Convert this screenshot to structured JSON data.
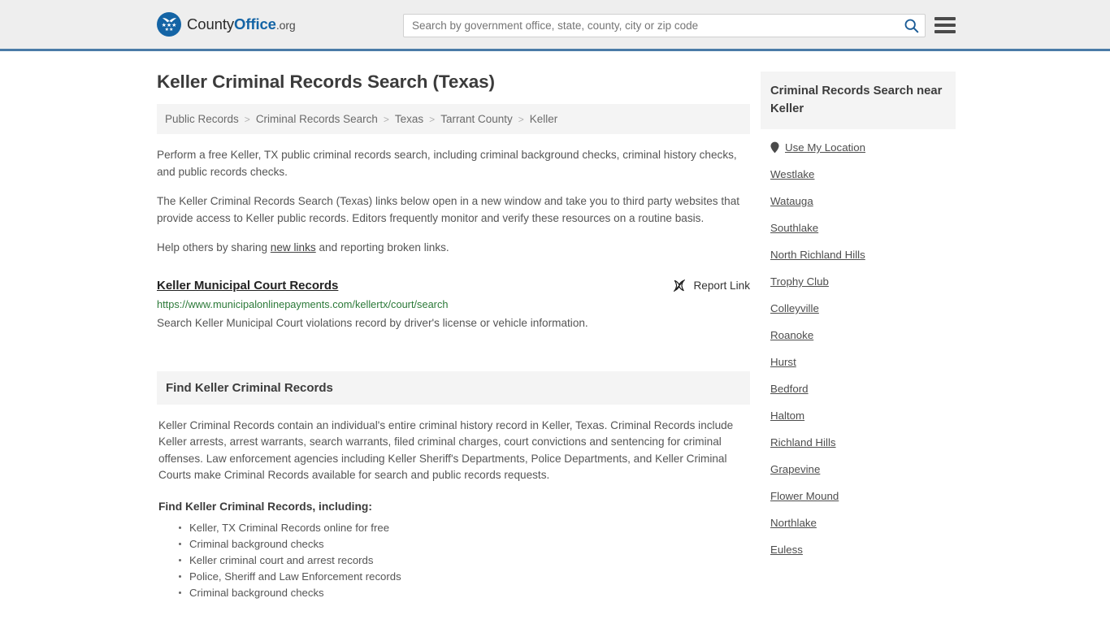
{
  "header": {
    "brand": {
      "part1": "County",
      "part2": "Office",
      "suffix": ".org"
    },
    "search": {
      "placeholder": "Search by government office, state, county, city or zip code",
      "value": "",
      "icon": "search-icon"
    },
    "menu_icon": "hamburger-menu-icon"
  },
  "main": {
    "title": "Keller Criminal Records Search (Texas)",
    "breadcrumb": [
      {
        "label": "Public Records",
        "current": false
      },
      {
        "label": "Criminal Records Search",
        "current": false
      },
      {
        "label": "Texas",
        "current": false
      },
      {
        "label": "Tarrant County",
        "current": false
      },
      {
        "label": "Keller",
        "current": true
      }
    ],
    "breadcrumb_separator": ">",
    "intro_paragraphs": [
      "Perform a free Keller, TX public criminal records search, including criminal background checks, criminal history checks, and public records checks.",
      "The Keller Criminal Records Search (Texas) links below open in a new window and take you to third party websites that provide access to Keller public records. Editors frequently monitor and verify these resources on a routine basis."
    ],
    "share_line": {
      "before": "Help others by sharing ",
      "link": "new links",
      "after": " and reporting broken links."
    },
    "result": {
      "title": "Keller Municipal Court Records",
      "report_label": "Report Link",
      "report_icon": "broken-link-icon",
      "url": "https://www.municipalonlinepayments.com/kellertx/court/search",
      "description": "Search Keller Municipal Court violations record by driver's license or vehicle information."
    },
    "section": {
      "heading": "Find Keller Criminal Records",
      "paragraph": "Keller Criminal Records contain an individual's entire criminal history record in Keller, Texas. Criminal Records include Keller arrests, arrest warrants, search warrants, filed criminal charges, court convictions and sentencing for criminal offenses. Law enforcement agencies including Keller Sheriff's Departments, Police Departments, and Keller Criminal Courts make Criminal Records available for search and public records requests.",
      "subheading": "Find Keller Criminal Records, including:",
      "bullets": [
        "Keller, TX Criminal Records online for free",
        "Criminal background checks",
        "Keller criminal court and arrest records",
        "Police, Sheriff and Law Enforcement records",
        "Criminal background checks"
      ]
    }
  },
  "sidebar": {
    "heading": "Criminal Records Search near Keller",
    "use_my_location": {
      "label": "Use My Location",
      "icon": "map-pin-icon"
    },
    "places": [
      "Westlake",
      "Watauga",
      "Southlake",
      "North Richland Hills",
      "Trophy Club",
      "Colleyville",
      "Roanoke",
      "Hurst",
      "Bedford",
      "Haltom",
      "Richland Hills",
      "Grapevine",
      "Flower Mound",
      "Northlake",
      "Euless"
    ]
  },
  "colors": {
    "header_bg": "#eeeeee",
    "header_border": "#4a7ba7",
    "brand_blue": "#1464a5",
    "panel_bg": "#f4f4f4",
    "url_green": "#2c7a39",
    "text": "#555555"
  }
}
